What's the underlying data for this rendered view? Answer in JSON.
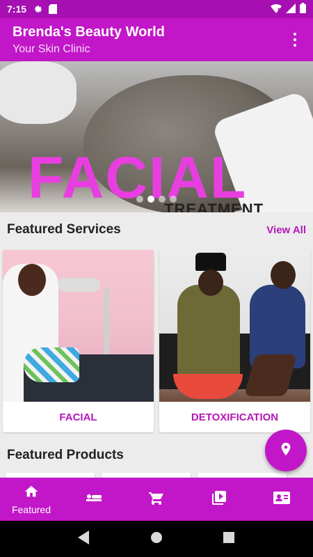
{
  "status_bar": {
    "time": "7:15",
    "icons_left": [
      "gear-icon",
      "sd-card-icon"
    ],
    "icons_right": [
      "wifi-icon",
      "signal-icon",
      "battery-icon"
    ]
  },
  "app_bar": {
    "title": "Brenda's Beauty World",
    "subtitle": "Your Skin Clinic",
    "menu_icon": "more-vert-icon"
  },
  "hero": {
    "banner_text": "FACIAL",
    "banner_subtext": "TREATMENT",
    "slide_count": 4,
    "active_slide": 2
  },
  "featured_services": {
    "title": "Featured Services",
    "view_all_label": "View All",
    "items": [
      {
        "label": "FACIAL"
      },
      {
        "label": "DETOXIFICATION"
      }
    ]
  },
  "featured_products": {
    "title": "Featured Products"
  },
  "fab": {
    "icon": "location-pin-icon"
  },
  "bottom_nav": {
    "items": [
      {
        "icon": "home-icon",
        "label": "Featured",
        "active": true
      },
      {
        "icon": "spa-bed-icon",
        "label": ""
      },
      {
        "icon": "cart-icon",
        "label": ""
      },
      {
        "icon": "video-library-icon",
        "label": ""
      },
      {
        "icon": "contact-card-icon",
        "label": ""
      }
    ]
  },
  "system_nav": {
    "icons": [
      "back-icon",
      "home-circle-icon",
      "recents-icon"
    ]
  },
  "colors": {
    "primary": "#c217c8",
    "primary_dark": "#a60fb2",
    "accent_text": "#b516b8",
    "background": "#ececec"
  }
}
